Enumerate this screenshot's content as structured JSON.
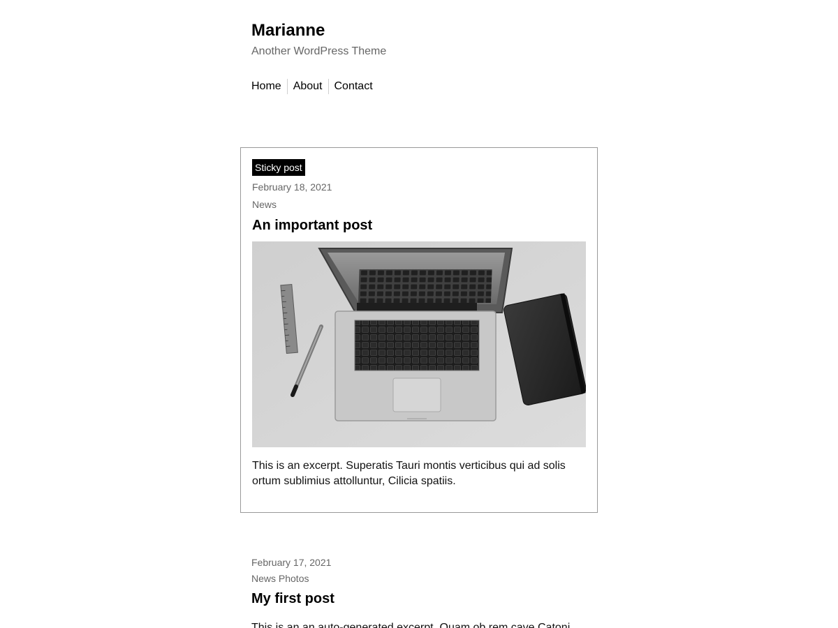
{
  "site": {
    "title": "Marianne",
    "description": "Another WordPress Theme"
  },
  "nav": {
    "items": [
      {
        "label": "Home"
      },
      {
        "label": "About"
      },
      {
        "label": "Contact"
      }
    ]
  },
  "posts": [
    {
      "badge": "Sticky post",
      "date": "February 18, 2021",
      "categories": "News",
      "title": "An important post",
      "image": "laptop-notebook-pen-desk-photo",
      "excerpt": "This is an excerpt. Superatis Tauri montis verticibus qui ad solis ortum sublimius attolluntur, Cilicia spatiis."
    },
    {
      "date": "February 17, 2021",
      "categories": "News Photos",
      "title": "My first post",
      "excerpt": "This is an an auto-generated excerpt. Quam ob rem cave Catoni"
    }
  ],
  "colors": {
    "text": "#111111",
    "muted": "#666666",
    "border": "#999999",
    "badge_bg": "#000000"
  }
}
